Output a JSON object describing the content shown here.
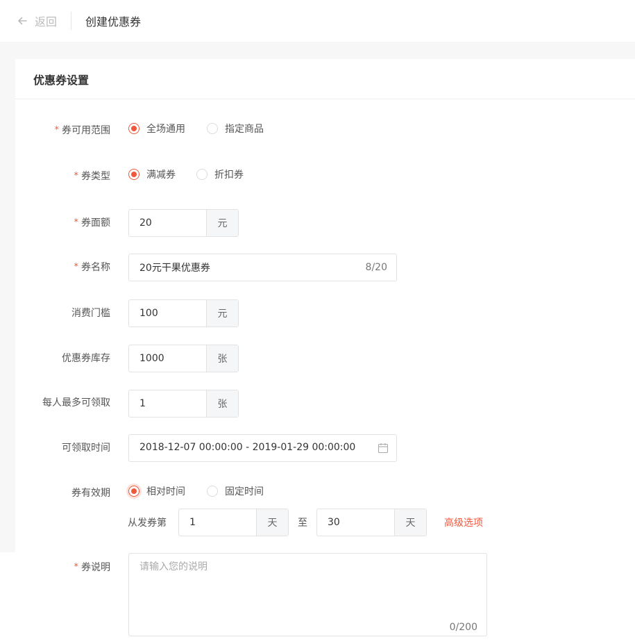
{
  "header": {
    "back_label": "返回",
    "title": "创建优惠券"
  },
  "card": {
    "title": "优惠券设置"
  },
  "form": {
    "scope": {
      "label": "券可用范围",
      "required": true,
      "options": [
        "全场通用",
        "指定商品"
      ],
      "selected": "全场通用"
    },
    "coupon_type": {
      "label": "券类型",
      "required": true,
      "options": [
        "满减券",
        "折扣券"
      ],
      "selected": "满减券"
    },
    "face_value": {
      "label": "券面额",
      "required": true,
      "value": "20",
      "unit": "元"
    },
    "coupon_name": {
      "label": "券名称",
      "required": true,
      "value": "20元干果优惠券",
      "counter": "8/20"
    },
    "threshold": {
      "label": "消费门槛",
      "value": "100",
      "unit": "元"
    },
    "stock": {
      "label": "优惠券库存",
      "value": "1000",
      "unit": "张"
    },
    "per_user_limit": {
      "label": "每人最多可领取",
      "value": "1",
      "unit": "张"
    },
    "claim_time": {
      "label": "可领取时间",
      "value": "2018-12-07 00:00:00 - 2019-01-29 00:00:00"
    },
    "validity": {
      "label": "券有效期",
      "options": [
        "相对时间",
        "固定时间"
      ],
      "selected": "相对时间",
      "from_label": "从发券第",
      "start_value": "1",
      "start_unit": "天",
      "to_label": "至",
      "end_value": "30",
      "end_unit": "天",
      "advanced_link": "高级选项"
    },
    "description": {
      "label": "券说明",
      "required": true,
      "placeholder": "请输入您的说明",
      "counter": "0/200"
    }
  },
  "colors": {
    "accent": "#f0583d",
    "required_mark": "#f0583d",
    "muted_text": "#bbbbbb",
    "border": "#e2e2e2",
    "addon_bg": "#f5f6f8"
  },
  "icons": {
    "back": "arrow-left-icon",
    "calendar": "calendar-icon"
  }
}
